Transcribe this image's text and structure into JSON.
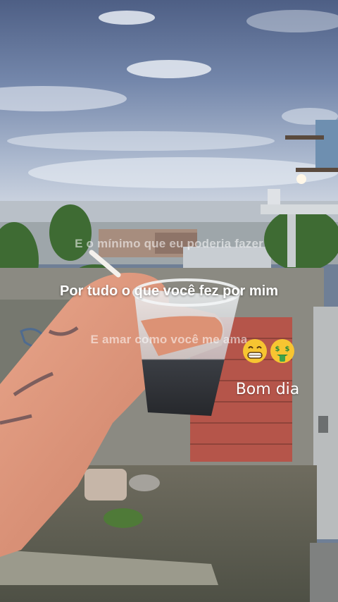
{
  "story": {
    "line_1": "E o mínimo que eu poderia fazer",
    "line_2": "Por tudo o que você fez por mim",
    "line_3": "E amar como você me ama",
    "line_4": "Bom dia"
  },
  "emojis": [
    "grinning-face-emoji",
    "money-mouth-face-emoji"
  ],
  "colors": {
    "sky": "#7d8fae",
    "clouds": "#e6ebf2",
    "brick": "#b8534a",
    "wall": "#8d8a80",
    "cup": "#d9dde0"
  }
}
